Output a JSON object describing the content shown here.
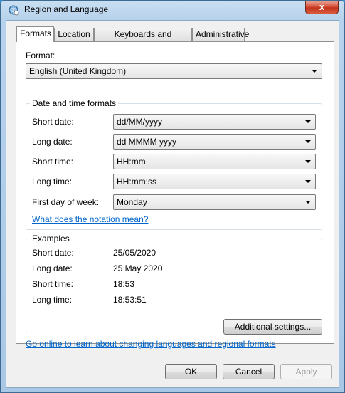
{
  "window": {
    "title": "Region and Language",
    "close_label": "x"
  },
  "tabs": [
    {
      "label": "Formats",
      "active": true
    },
    {
      "label": "Location",
      "active": false
    },
    {
      "label": "Keyboards and Languages",
      "active": false
    },
    {
      "label": "Administrative",
      "active": false
    }
  ],
  "format": {
    "label": "Format:",
    "value": "English (United Kingdom)"
  },
  "date_time_formats": {
    "title": "Date and time formats",
    "rows": [
      {
        "label": "Short date:",
        "value": "dd/MM/yyyy"
      },
      {
        "label": "Long date:",
        "value": "dd MMMM yyyy"
      },
      {
        "label": "Short time:",
        "value": "HH:mm"
      },
      {
        "label": "Long time:",
        "value": "HH:mm:ss"
      },
      {
        "label": "First day of week:",
        "value": "Monday"
      }
    ],
    "notation_link": "What does the notation mean?"
  },
  "examples": {
    "title": "Examples",
    "rows": [
      {
        "label": "Short date:",
        "value": "25/05/2020"
      },
      {
        "label": "Long date:",
        "value": "25 May 2020"
      },
      {
        "label": "Short time:",
        "value": "18:53"
      },
      {
        "label": "Long time:",
        "value": "18:53:51"
      }
    ]
  },
  "additional_settings_label": "Additional settings...",
  "online_link": "Go online to learn about changing languages and regional formats",
  "buttons": {
    "ok": "OK",
    "cancel": "Cancel",
    "apply": "Apply"
  }
}
